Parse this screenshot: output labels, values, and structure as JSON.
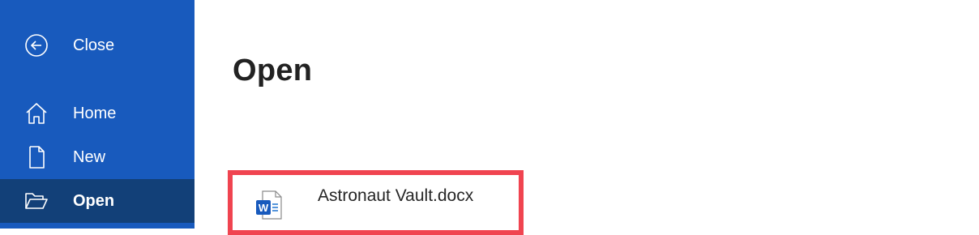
{
  "sidebar": {
    "items": [
      {
        "label": "Close",
        "icon": "back-arrow-icon"
      },
      {
        "label": "Home",
        "icon": "home-icon"
      },
      {
        "label": "New",
        "icon": "new-document-icon"
      },
      {
        "label": "Open",
        "icon": "folder-open-icon",
        "selected": true
      }
    ],
    "background": "#185abd",
    "selected_background": "#124078"
  },
  "main": {
    "title": "Open",
    "files": [
      {
        "name": "Astronaut Vault.docx",
        "icon": "word-document-icon",
        "highlight_color": "#f04450"
      }
    ]
  }
}
